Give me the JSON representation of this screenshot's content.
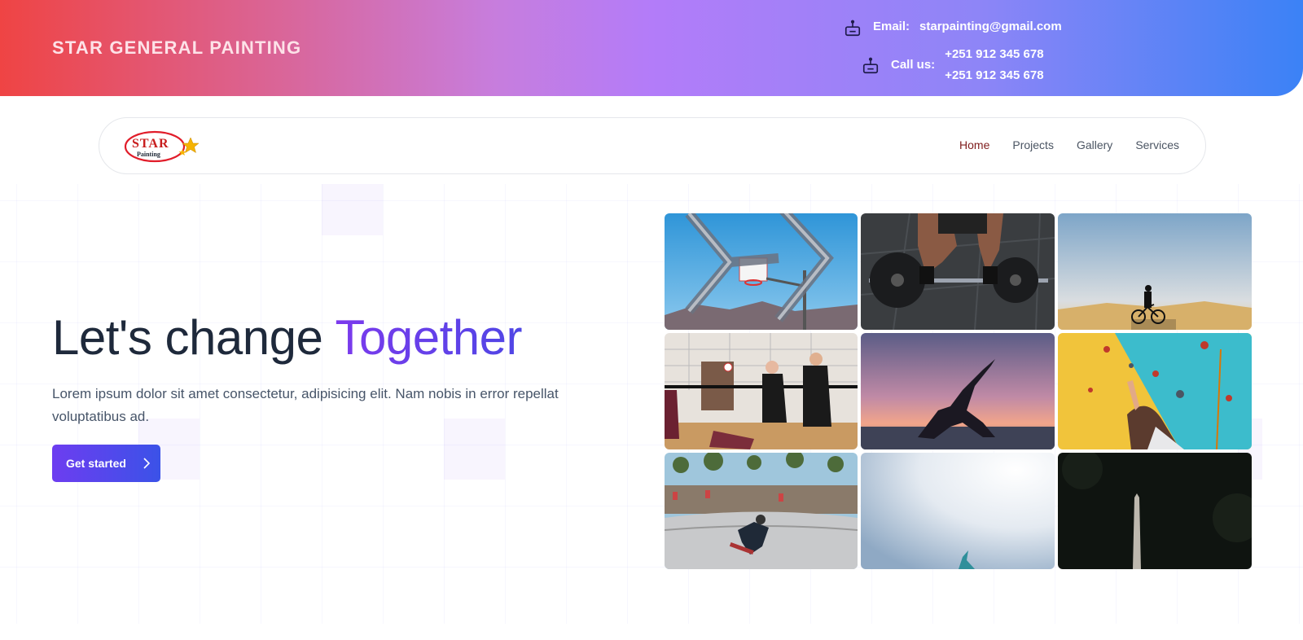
{
  "header": {
    "brand": "STAR GENERAL PAINTING",
    "email_label": "Email:",
    "email": "starpainting@gmail.com",
    "call_label": "Call us:",
    "phones": [
      "+251 912 345 678",
      "+251 912 345 678"
    ]
  },
  "nav": {
    "logo_top": "STAR",
    "logo_bottom": "Painting",
    "links": [
      "Home",
      "Projects",
      "Gallery",
      "Services"
    ]
  },
  "hero": {
    "title_plain": "Let's change ",
    "title_accent": "Together",
    "description": "Lorem ipsum dolor sit amet consectetur, adipisicing elit. Nam nobis in error repellat voluptatibus ad.",
    "cta_label": "Get started"
  },
  "gallery": [
    "basketball-hoop-through-fence",
    "weightlifter-barbell",
    "cyclist-on-hilltop",
    "volleyball-players",
    "yoga-sunset",
    "rock-climbing-wall",
    "skateboarder-bowl",
    "person-in-bright-sky",
    "dark-pole-closeup"
  ],
  "colors": {
    "accent": "#4f46e5",
    "active_nav": "#7f1d1d",
    "banner_start": "#ef4444",
    "banner_end": "#3b82f6"
  }
}
